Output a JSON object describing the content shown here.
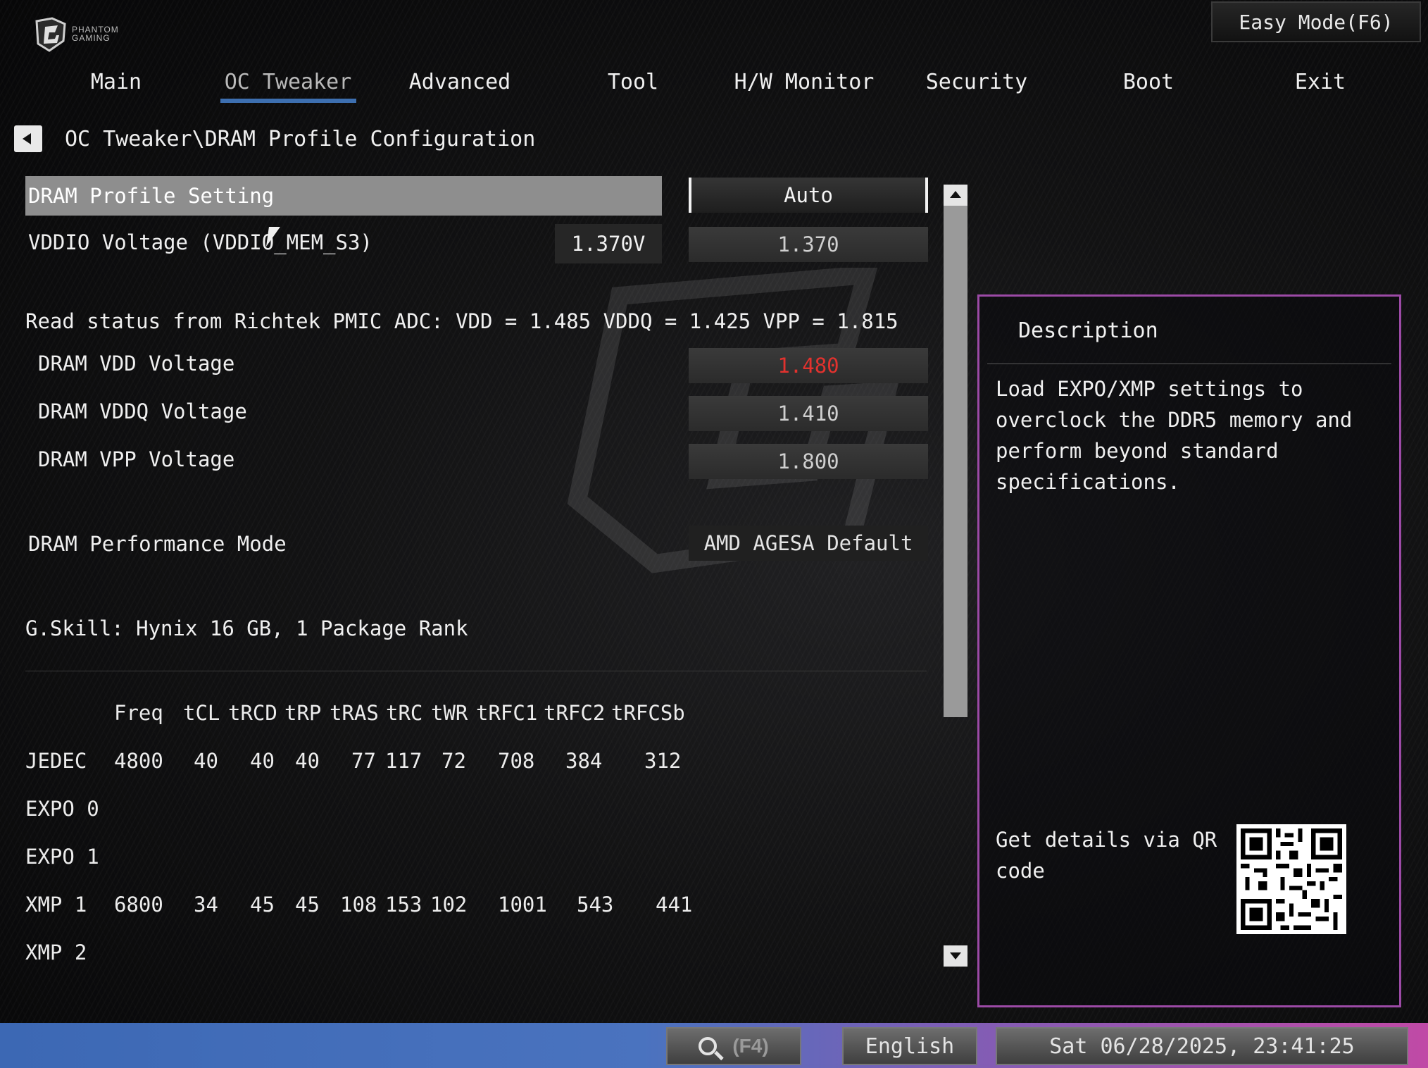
{
  "header": {
    "brand_lines": [
      "PHANTOM",
      "GAMING"
    ],
    "easy_mode_label": "Easy Mode(F6)"
  },
  "nav": {
    "tabs": [
      {
        "label": "Main"
      },
      {
        "label": "OC Tweaker"
      },
      {
        "label": "Advanced"
      },
      {
        "label": "Tool"
      },
      {
        "label": "H/W Monitor"
      },
      {
        "label": "Security"
      },
      {
        "label": "Boot"
      },
      {
        "label": "Exit"
      }
    ],
    "active": "OC Tweaker"
  },
  "breadcrumb": "OC Tweaker\\DRAM Profile Configuration",
  "settings": {
    "dram_profile": {
      "label": "DRAM Profile Setting",
      "value": "Auto"
    },
    "vddio": {
      "label": "VDDIO Voltage (VDDIO_MEM_S3)",
      "readout": "1.370V",
      "value": "1.370"
    },
    "pmic_status": "Read status from Richtek PMIC ADC: VDD = 1.485 VDDQ = 1.425 VPP = 1.815",
    "vdd": {
      "label": "DRAM VDD Voltage",
      "value": "1.480",
      "color": "#e2322e"
    },
    "vddq": {
      "label": "DRAM VDDQ Voltage",
      "value": "1.410"
    },
    "vpp": {
      "label": "DRAM VPP Voltage",
      "value": "1.800"
    },
    "perf_mode": {
      "label": "DRAM Performance Mode",
      "value": "AMD AGESA Default"
    },
    "memory_info": "G.Skill: Hynix 16 GB, 1 Package Rank"
  },
  "timings": {
    "headers": [
      "Freq",
      "tCL",
      "tRCD",
      "tRP",
      "tRAS",
      "tRC",
      "tWR",
      "tRFC1",
      "tRFC2",
      "tRFCSb"
    ],
    "rows": [
      {
        "name": "JEDEC",
        "values": [
          "4800",
          "40",
          "40",
          "40",
          "77",
          "117",
          "72",
          "708",
          "384",
          "312"
        ]
      },
      {
        "name": "EXPO 0",
        "values": []
      },
      {
        "name": "EXPO 1",
        "values": []
      },
      {
        "name": "XMP 1",
        "values": [
          "6800",
          "34",
          "45",
          "45",
          "108",
          "153",
          "102",
          "1001",
          "543",
          "441"
        ]
      },
      {
        "name": "XMP 2",
        "values": []
      }
    ]
  },
  "description": {
    "title": "Description",
    "text": "Load EXPO/XMP settings to overclock the DDR5 memory and perform beyond standard specifications.",
    "qr_text": "Get details via QR code"
  },
  "bottom_bar": {
    "search_key": "(F4)",
    "language": "English",
    "datetime": "Sat 06/28/2025, 23:41:25"
  },
  "colors": {
    "accent": "#3d6fb0",
    "panel_border": "#9c4aa6",
    "warning_value": "#e2322e"
  }
}
